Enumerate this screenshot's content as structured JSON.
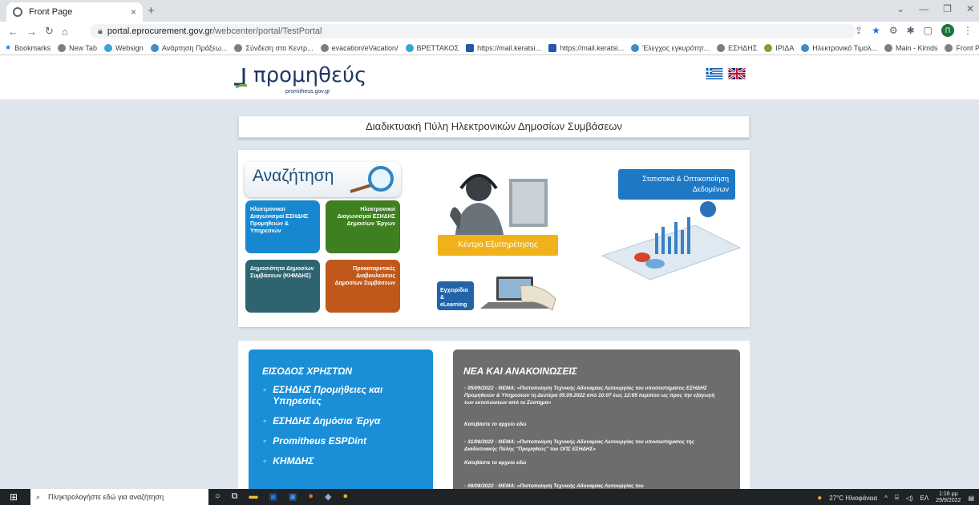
{
  "browser": {
    "tab_title": "Front Page",
    "tab_close": "×",
    "new_tab": "+",
    "url_host": "portal.eprocurement.gov.gr",
    "url_path": "/webcenter/portal/TestPortal",
    "avatar_letter": "Π"
  },
  "bookmarks": [
    "Bookmarks",
    "New Tab",
    "Websign",
    "Ανάρτηση Πράξεω...",
    "Σύνδεση στο Κεντρ...",
    "evacation/eVacation/",
    "ΒΡΕΤΤΑΚΟΣ",
    "https://mail.keratsi...",
    "https://mail.keratsi...",
    "Έλεγχος εγκυρότητ...",
    "ΕΣΗΔΗΣ",
    "ΙΡΙΔΑ",
    "Ηλεκτρονικό Τιμολ...",
    "Main - Kimds",
    "Front Page"
  ],
  "site": {
    "logo_text": "προμηθεύς",
    "logo_sub": "promitheus.gov.gr",
    "portal_title": "Διαδικτυακή Πύλη Ηλεκτρονικών Δημοσίων Συμβάσεων"
  },
  "search": {
    "title": "Αναζήτηση",
    "tiles": [
      "Ηλεκτρονικοί Διαγωνισμοί ΕΣΗΔΗΣ Προμηθειών & Υπηρεσιών",
      "Ηλεκτρονικοί Διαγωνισμοί ΕΣΗΔΗΣ Δημοσίων Έργων",
      "Δημοσιότητα Δημοσίων Συμβάσεων (ΚΗΜΔΗΣ)",
      "Προκαταρκτικές Διαβουλεύσεις Δημοσίων Συμβάσεων"
    ]
  },
  "support": {
    "label": "Κέντρο Εξυπηρέτησης"
  },
  "elearning": {
    "label": "Εγχειρίδια & eLearning"
  },
  "stats": {
    "label": "Στατιστικά & Οπτικοποίηση Δεδομένων"
  },
  "users": {
    "title": "ΕΙΣΟΔΟΣ ΧΡΗΣΤΩΝ",
    "items": [
      "ΕΣΗΔΗΣ Προμήθειες και Υπηρεσίες",
      "ΕΣΗΔΗΣ Δημόσια Έργα",
      "Promitheus ESPDint",
      "ΚΗΜΔΗΣ"
    ]
  },
  "news": {
    "title": "ΝΕΑ ΚΑΙ ΑΝΑΚΟΙΝΩΣΕΙΣ",
    "items": [
      {
        "text": "05/09/2022 - ΘΕΜΑ: «Πιστοποίηση Τεχνικής Αδυναμίας Λειτουργίας του υποσυστήματος ΕΣΗΔΗΣ Προμηθειών & Υπηρεσιών τη Δευτέρα 05.09.2022 από 10:07 έως 12:05 περίπου ως προς την εξαγωγή των εκτυπώσεων από το Σύστημα»",
        "link": "Κατεβάστε το αρχείο εδώ"
      },
      {
        "text": "31/08/2022 - ΘΕΜΑ: «Πιστοποίηση Τεχνικής Αδυναμίας Λειτουργίας του υποσυστήματος της Διαδικτυακής Πύλης \"Προμηθεύς\" του ΟΠΣ ΕΣΗΔΗΣ»",
        "link": "Κατεβάστε το αρχείο εδώ"
      },
      {
        "text": "08/08/2022 - ΘΕΜΑ: «Πιστοποίηση Τεχνικής Αδυναμίας Λειτουργίας του",
        "link": ""
      }
    ]
  },
  "taskbar": {
    "search_placeholder": "Πληκτρολογήστε εδώ για αναζήτηση",
    "weather": "27°C Ηλιοφάνεια",
    "lang": "ΕΛ",
    "time": "1:16 μμ",
    "date": "29/9/2022"
  }
}
